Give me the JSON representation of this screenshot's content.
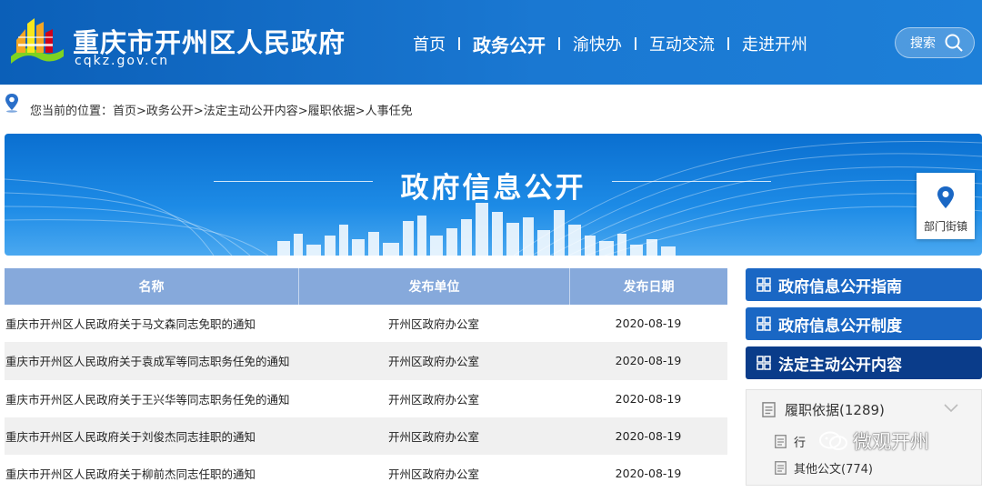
{
  "header": {
    "site_name": "重庆市开州区人民政府",
    "domain": "cqkz.gov.cn",
    "nav": [
      {
        "label": "首页"
      },
      {
        "label": "政务公开"
      },
      {
        "label": "渝快办"
      },
      {
        "label": "互动交流"
      },
      {
        "label": "走进开州"
      }
    ],
    "search_label": "搜索"
  },
  "breadcrumb": {
    "text": "您当前的位置：首页>政务公开>法定主动公开内容>履职依据>人事任免"
  },
  "banner": {
    "title": "政府信息公开",
    "dept_label": "部门街镇"
  },
  "table": {
    "headers": [
      "名称",
      "发布单位",
      "发布日期"
    ],
    "rows": [
      {
        "title": "重庆市开州区人民政府关于马文森同志免职的通知",
        "unit": "开州区政府办公室",
        "date": "2020-08-19"
      },
      {
        "title": "重庆市开州区人民政府关于袁成军等同志职务任免的通知",
        "unit": "开州区政府办公室",
        "date": "2020-08-19"
      },
      {
        "title": "重庆市开州区人民政府关于王兴华等同志职务任免的通知",
        "unit": "开州区政府办公室",
        "date": "2020-08-19"
      },
      {
        "title": "重庆市开州区人民政府关于刘俊杰同志挂职的通知",
        "unit": "开州区政府办公室",
        "date": "2020-08-19"
      },
      {
        "title": "重庆市开州区人民政府关于柳前杰同志任职的通知",
        "unit": "开州区政府办公室",
        "date": "2020-08-19"
      }
    ]
  },
  "sidebar": {
    "buttons": [
      {
        "label": "政府信息公开指南"
      },
      {
        "label": "政府信息公开制度"
      },
      {
        "label": "法定主动公开内容"
      }
    ],
    "panel": {
      "main_item": "履职依据(1289)",
      "sub_items": [
        {
          "label": "行"
        },
        {
          "label": "其他公文(774)"
        }
      ]
    }
  },
  "watermark": "微观开州",
  "colors": {
    "header_blue": "#1a78d2",
    "table_header": "#86a9db",
    "sidebar_button": "#1a67c4",
    "sidebar_active": "#0a3c8a"
  }
}
